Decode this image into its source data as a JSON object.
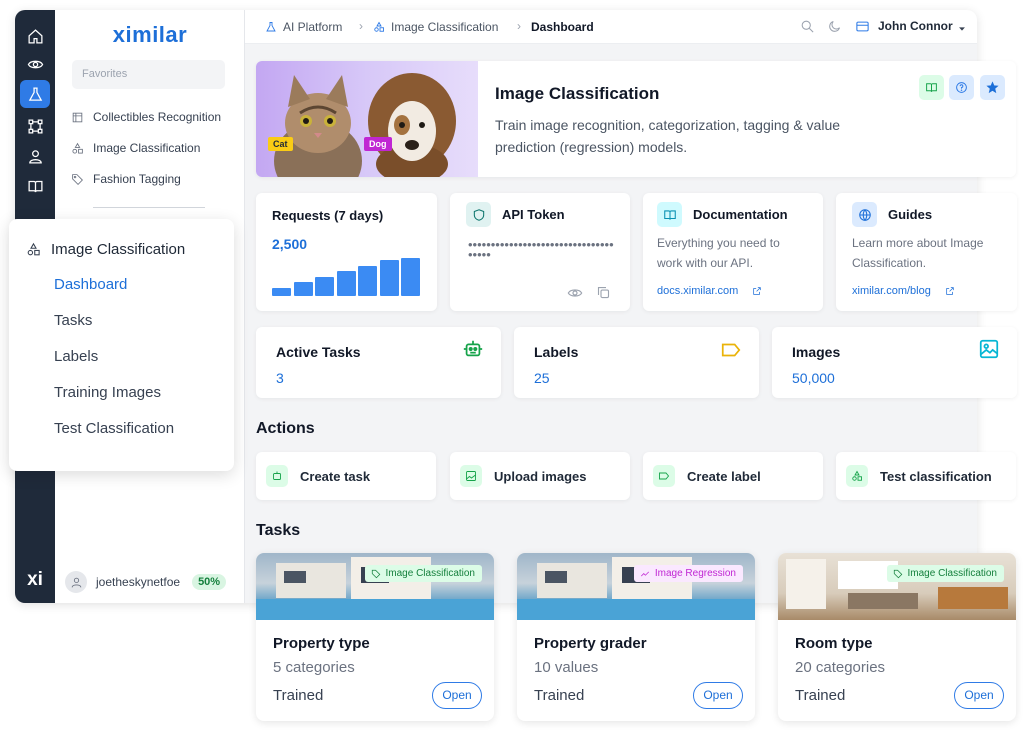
{
  "brand": {
    "logo": "ximilar",
    "rail_logo": "xi"
  },
  "rail_icons": [
    "home-icon",
    "eye-icon",
    "flask-icon",
    "nodes-icon",
    "person-icon",
    "book-icon"
  ],
  "sidebar": {
    "favorites_placeholder": "Favorites",
    "items": [
      {
        "label": "Collectibles Recognition",
        "icon": "collectibles-icon"
      },
      {
        "label": "Image Classification",
        "icon": "shapes-icon"
      },
      {
        "label": "Fashion Tagging",
        "icon": "tag-icon"
      }
    ],
    "user": {
      "name": "joetheskynetfoe",
      "badge": "50%"
    }
  },
  "topbar": {
    "breadcrumbs": [
      "AI Platform",
      "Image Classification",
      "Dashboard"
    ],
    "user_name": "John Connor"
  },
  "hero": {
    "title": "Image Classification",
    "description": "Train image recognition, categorization, tagging & value prediction (regression) models.",
    "tag_cat": "Cat",
    "tag_dog": "Dog"
  },
  "cards": {
    "requests": {
      "title": "Requests (7 days)",
      "value": "2,500",
      "bars": [
        0.2,
        0.36,
        0.5,
        0.66,
        0.8,
        0.96,
        1.0
      ]
    },
    "api_token": {
      "title": "API Token",
      "masked": "•••••••••••••••••••••••••••••••••••••"
    },
    "documentation": {
      "title": "Documentation",
      "text": "Everything you need to work with our API.",
      "link": "docs.ximilar.com"
    },
    "guides": {
      "title": "Guides",
      "text": "Learn more about Image Classification.",
      "link": "ximilar.com/blog"
    }
  },
  "stats": [
    {
      "title": "Active Tasks",
      "value": "3",
      "icon": "robot-icon",
      "color": "#16a34a"
    },
    {
      "title": "Labels",
      "value": "25",
      "icon": "label-icon",
      "color": "#eab308"
    },
    {
      "title": "Images",
      "value": "50,000",
      "icon": "image-icon",
      "color": "#06b6d4"
    }
  ],
  "actions": {
    "title": "Actions",
    "items": [
      {
        "label": "Create task",
        "icon": "robot-icon"
      },
      {
        "label": "Upload images",
        "icon": "image-icon"
      },
      {
        "label": "Create label",
        "icon": "label-icon"
      },
      {
        "label": "Test classification",
        "icon": "shapes-icon"
      }
    ]
  },
  "tasks": {
    "title": "Tasks",
    "items": [
      {
        "name": "Property type",
        "meta": "5 categories",
        "status": "Trained",
        "badge": "Image Classification",
        "badge_type": "classification",
        "open": "Open"
      },
      {
        "name": "Property grader",
        "meta": "10 values",
        "status": "Trained",
        "badge": "Image Regression",
        "badge_type": "regression",
        "open": "Open"
      },
      {
        "name": "Room type",
        "meta": "20 categories",
        "status": "Trained",
        "badge": "Image Classification",
        "badge_type": "classification",
        "open": "Open"
      }
    ]
  },
  "submenu": {
    "title": "Image Classification",
    "items": [
      "Dashboard",
      "Tasks",
      "Labels",
      "Training Images",
      "Test Classification"
    ],
    "active": "Dashboard"
  },
  "colors": {
    "accent": "#1d6fd8",
    "rail": "#1f2a3a",
    "success": "#16a34a",
    "regression": "#c026d3"
  }
}
